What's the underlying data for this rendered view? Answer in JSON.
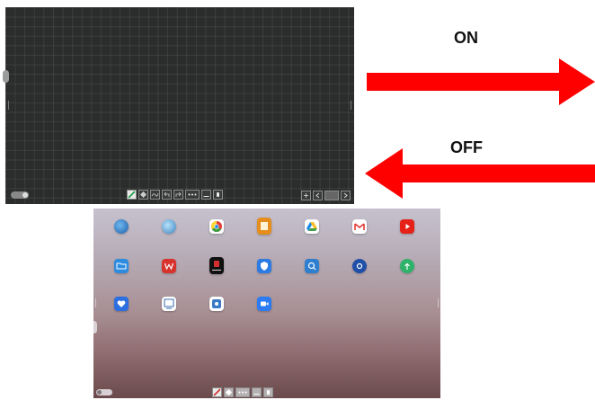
{
  "labels": {
    "on": "ON",
    "off": "OFF"
  },
  "colors": {
    "arrow": "#ff0000",
    "whiteboard_bg": "#2b2d2c"
  },
  "whiteboard": {
    "toolbar_icons": [
      "pen-icon",
      "eraser-icon",
      "shape-icon",
      "undo-icon",
      "redo-icon",
      "more-icon",
      "minimize-icon",
      "hand-icon"
    ],
    "page_icons": [
      "add-page-icon",
      "prev-page-icon",
      "page-indicator-icon",
      "next-page-icon"
    ]
  },
  "launcher": {
    "apps": [
      {
        "row": 0,
        "col": 0,
        "icon": "globe-icon",
        "color": "#2a6fc2"
      },
      {
        "row": 0,
        "col": 1,
        "icon": "globe-icon",
        "color": "#4f9fd6"
      },
      {
        "row": 0,
        "col": 2,
        "icon": "chrome-icon",
        "color": "#ffffff"
      },
      {
        "row": 0,
        "col": 3,
        "icon": "book-icon",
        "color": "#e58e1d"
      },
      {
        "row": 0,
        "col": 4,
        "icon": "drive-icon",
        "color": "#ffffff"
      },
      {
        "row": 0,
        "col": 5,
        "icon": "gmail-icon",
        "color": "#ffffff"
      },
      {
        "row": 0,
        "col": 6,
        "icon": "youtube-icon",
        "color": "#e62117"
      },
      {
        "row": 1,
        "col": 0,
        "icon": "folder-icon",
        "color": "#2d8be0"
      },
      {
        "row": 1,
        "col": 1,
        "icon": "wps-icon",
        "color": "#d8322c"
      },
      {
        "row": 1,
        "col": 2,
        "icon": "app-icon",
        "color": "#111111"
      },
      {
        "row": 1,
        "col": 3,
        "icon": "shield-icon",
        "color": "#2b7be3"
      },
      {
        "row": 1,
        "col": 4,
        "icon": "search-icon",
        "color": "#2f7fd0"
      },
      {
        "row": 1,
        "col": 5,
        "icon": "settings-icon",
        "color": "#1f4fa8"
      },
      {
        "row": 1,
        "col": 6,
        "icon": "upload-icon",
        "color": "#2fb36b"
      },
      {
        "row": 2,
        "col": 0,
        "icon": "heart-icon",
        "color": "#2b6fe0"
      },
      {
        "row": 2,
        "col": 1,
        "icon": "whiteboard-icon",
        "color": "#ffffff"
      },
      {
        "row": 2,
        "col": 2,
        "icon": "gear-icon",
        "color": "#ffffff"
      },
      {
        "row": 2,
        "col": 3,
        "icon": "video-icon",
        "color": "#2b7bf2"
      }
    ],
    "toolbar_icons": [
      "pen-icon",
      "eraser-icon",
      "more-icon",
      "minimize-icon",
      "hand-icon"
    ]
  }
}
